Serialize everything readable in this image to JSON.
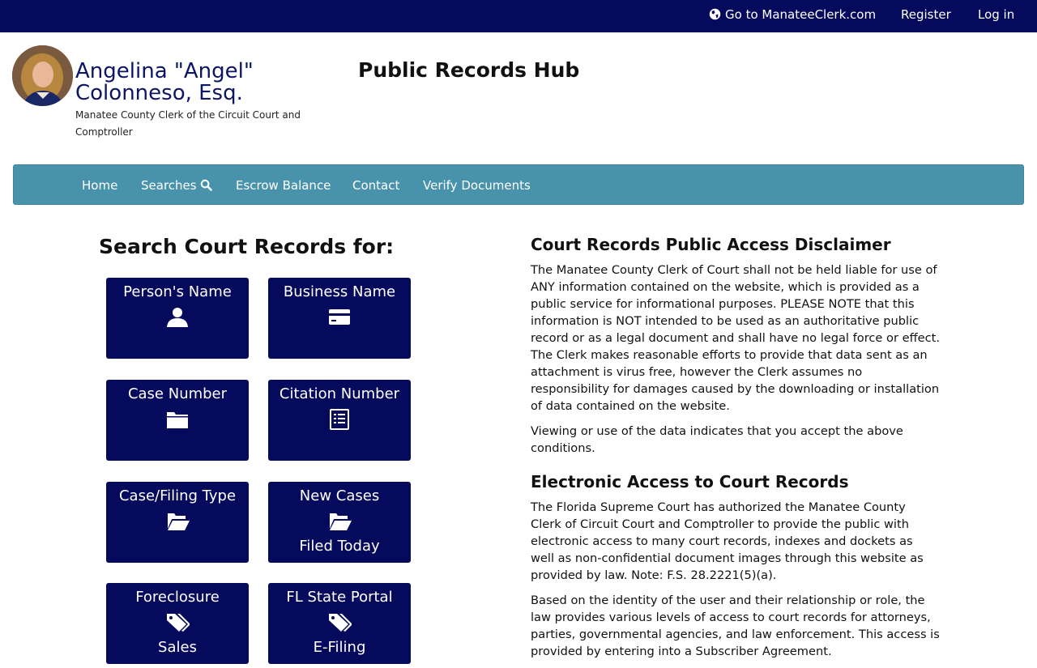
{
  "topbar": {
    "goto_label": "Go to ManateeClerk.com",
    "register_label": "Register",
    "login_label": "Log in"
  },
  "header": {
    "clerk_name_line1": "Angelina \"Angel\"",
    "clerk_name_line2": "Colonneso, Esq.",
    "clerk_title": "Manatee County Clerk of the Circuit Court and Comptroller",
    "hub_title": "Public Records Hub"
  },
  "nav": {
    "home": "Home",
    "searches": "Searches",
    "escrow": "Escrow Balance",
    "contact": "Contact",
    "verify": "Verify Documents"
  },
  "search": {
    "heading": "Search Court Records for:",
    "tiles": [
      {
        "label": "Person's Name",
        "icon": "user-icon",
        "sub": ""
      },
      {
        "label": "Business Name",
        "icon": "credit-card-icon",
        "sub": ""
      },
      {
        "label": "Case Number",
        "icon": "folder-icon",
        "sub": ""
      },
      {
        "label": "Citation Number",
        "icon": "list-alt-icon",
        "sub": ""
      },
      {
        "label": "Case/Filing Type",
        "icon": "folder-open-icon",
        "sub": ""
      },
      {
        "label": "New Cases",
        "icon": "folder-open-icon",
        "sub": "Filed Today"
      },
      {
        "label": "Foreclosure",
        "icon": "tags-icon",
        "sub": "Sales"
      },
      {
        "label": "FL State Portal",
        "icon": "tags-icon",
        "sub": "E-Filing"
      }
    ]
  },
  "disclaimer": {
    "heading": "Court Records Public Access Disclaimer",
    "p1": "The Manatee County Clerk of Court shall not be held liable for use of ANY information contained on the website, which is provided as a public service for informational purposes. PLEASE NOTE that this information is NOT intended to be used as an authoritative public record or as a legal document and shall have no legal force or effect. The Clerk makes reasonable efforts to provide that data sent as an attachment is virus free, however the Clerk assumes no responsibility for damages caused by the downloading or installation of data contained on the website.",
    "p2": "Viewing or use of the data indicates that you accept the above conditions."
  },
  "electronic": {
    "heading": "Electronic Access to Court Records",
    "p1": "The Florida Supreme Court has authorized the Manatee County Clerk of Circuit Court and Comptroller to provide the public with electronic access to many court records, indexes and dockets as well as non-confidential document images through this website as provided by law. Note: F.S. 28.2221(5)(a).",
    "p2": "Based on the identity of the user and their relationship or role, the law provides various levels of access to court records for attorneys, parties, governmental agencies, and law enforcement. This access is provided by entering into a Subscriber Agreement."
  },
  "colors": {
    "navy": "#050a5c",
    "nav_teal": "#4893ab"
  }
}
